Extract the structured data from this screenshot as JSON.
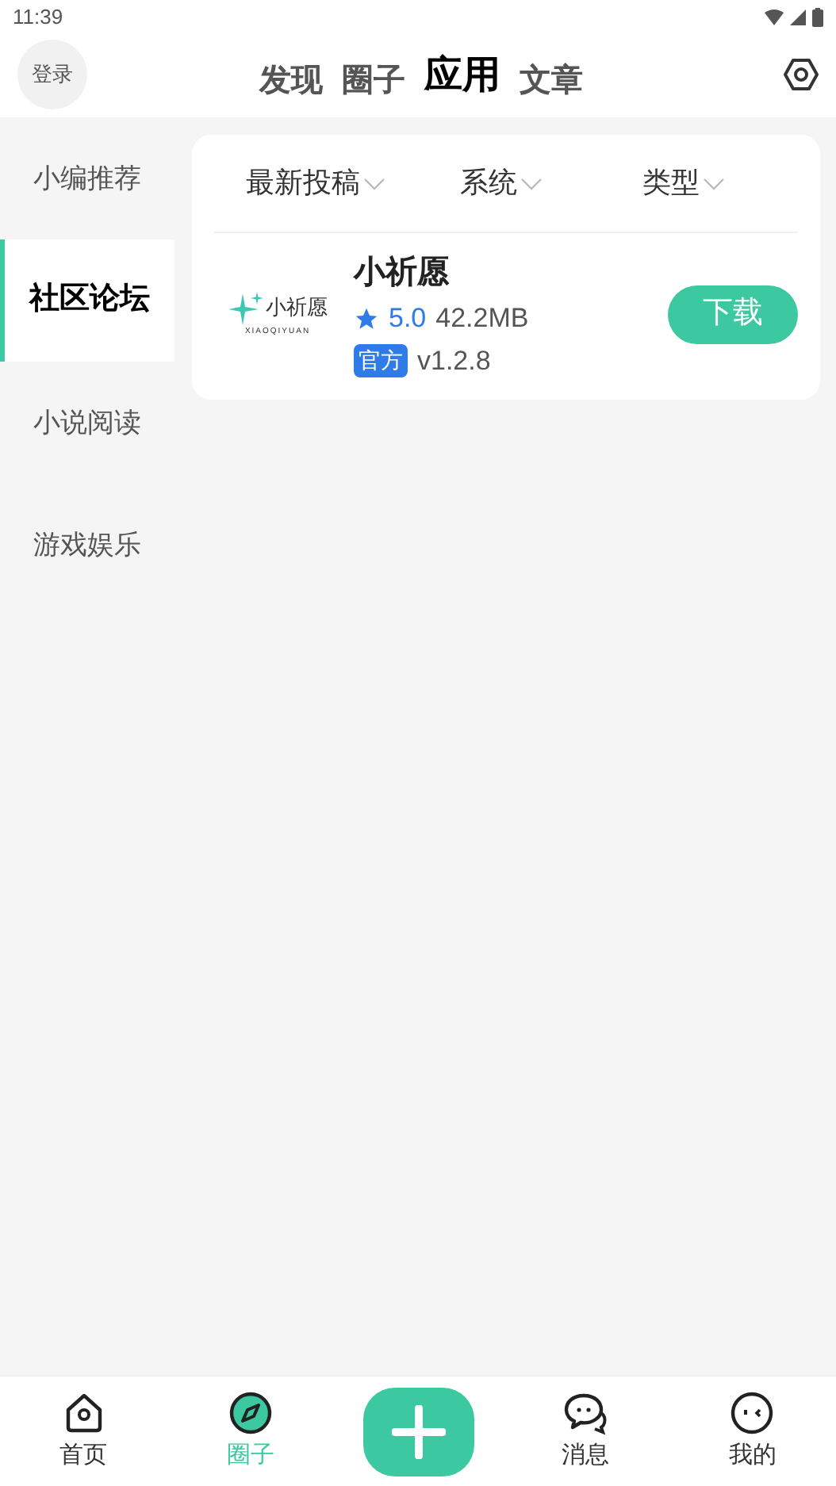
{
  "status_bar": {
    "time": "11:39"
  },
  "header": {
    "login": "登录",
    "tabs": [
      {
        "label": "发现",
        "selected": false
      },
      {
        "label": "圈子",
        "selected": false
      },
      {
        "label": "应用",
        "selected": true
      },
      {
        "label": "文章",
        "selected": false
      }
    ]
  },
  "sidebar": {
    "items": [
      {
        "label": "小编推荐",
        "selected": false
      },
      {
        "label": "社区论坛",
        "selected": true
      },
      {
        "label": "小说阅读",
        "selected": false
      },
      {
        "label": "游戏娱乐",
        "selected": false
      }
    ]
  },
  "filters": [
    "最新投稿",
    "系统",
    "类型"
  ],
  "apps": [
    {
      "logo_text": "小祈愿",
      "logo_subtext": "XIAOQIYUAN",
      "name": "小祈愿",
      "rating": "5.0",
      "size": "42.2MB",
      "badge": "官方",
      "version": "v1.2.8",
      "button": "下载"
    }
  ],
  "bottom_nav": [
    {
      "kind": "tab",
      "label": "首页",
      "selected": false
    },
    {
      "kind": "tab",
      "label": "圈子",
      "selected": true
    },
    {
      "kind": "add"
    },
    {
      "kind": "tab",
      "label": "消息",
      "selected": false
    },
    {
      "kind": "tab",
      "label": "我的",
      "selected": false
    }
  ]
}
